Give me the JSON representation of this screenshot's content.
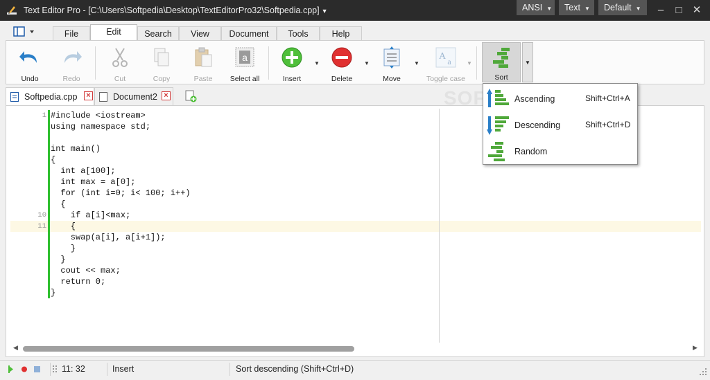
{
  "titlebar": {
    "title": "Text Editor Pro  -  [C:\\Users\\Softpedia\\Desktop\\TextEditorPro32\\Softpedia.cpp]",
    "encoding": "ANSI",
    "mode": "Text",
    "theme": "Default"
  },
  "menu": {
    "tabs": [
      "File",
      "Edit",
      "Search",
      "View",
      "Document",
      "Tools",
      "Help"
    ],
    "active": "Edit"
  },
  "ribbon": {
    "undo": "Undo",
    "redo": "Redo",
    "cut": "Cut",
    "copy": "Copy",
    "paste": "Paste",
    "select_all": "Select all",
    "insert": "Insert",
    "delete": "Delete",
    "move": "Move",
    "toggle_case": "Toggle case",
    "sort": "Sort"
  },
  "sort_menu": {
    "items": [
      {
        "label": "Ascending",
        "shortcut": "Shift+Ctrl+A"
      },
      {
        "label": "Descending",
        "shortcut": "Shift+Ctrl+D"
      },
      {
        "label": "Random",
        "shortcut": ""
      }
    ]
  },
  "doc_tabs": [
    {
      "name": "Softpedia.cpp",
      "active": true
    },
    {
      "name": "Document2",
      "active": false
    }
  ],
  "editor": {
    "line_numbers": [
      "1",
      "",
      "",
      "",
      "",
      "",
      "",
      "",
      "",
      "10",
      "11",
      "",
      "",
      "",
      "",
      "",
      ""
    ],
    "lines": [
      "#include <iostream>",
      "using namespace std;",
      "",
      "int main()",
      "{",
      "  int a[100];",
      "  int max = a[0];",
      "  for (int i=0; i< 100; i++)",
      "  {",
      "    if a[i]<max;",
      "    {",
      "    swap(a[i], a[i+1]);",
      "    }",
      "  }",
      "  cout << max;",
      "  return 0;",
      "}"
    ],
    "current_line": 11
  },
  "status": {
    "position": "11: 32",
    "mode": "Insert",
    "message": "Sort descending (Shift+Ctrl+D)"
  },
  "colors": {
    "titlebar": "#2b2b2b",
    "green_accent": "#2fbf2f",
    "delete_red": "#e03030",
    "current_line": "#fdf8e4"
  },
  "watermark": "SOFTPEDIA"
}
